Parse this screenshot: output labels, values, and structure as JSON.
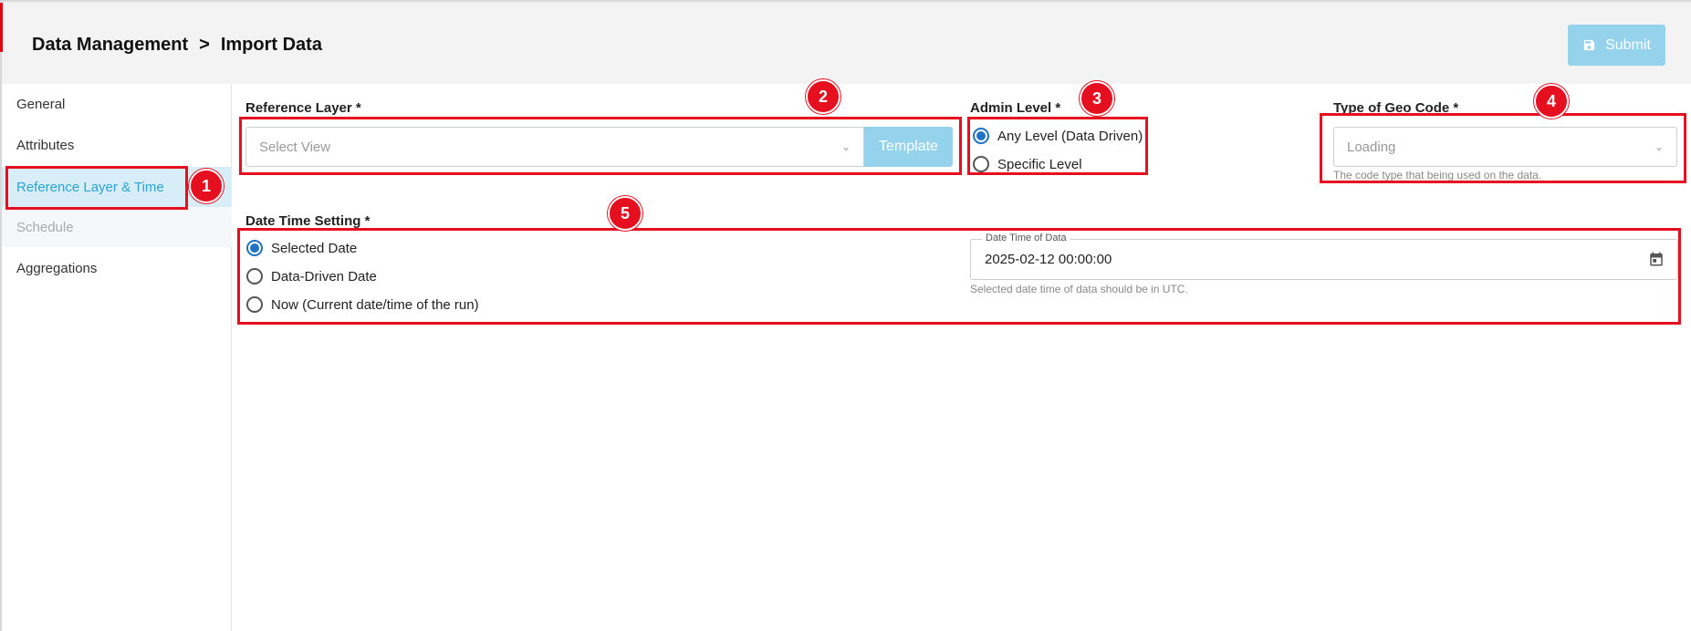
{
  "header": {
    "breadcrumb": [
      "Data Management",
      "Import Data"
    ],
    "separator": ">",
    "submit_label": "Submit"
  },
  "sidebar": {
    "items": [
      {
        "label": "General"
      },
      {
        "label": "Attributes"
      },
      {
        "label": "Reference Layer & Time"
      },
      {
        "label": "Schedule"
      },
      {
        "label": "Aggregations"
      }
    ]
  },
  "reference_layer": {
    "label": "Reference Layer *",
    "placeholder": "Select View",
    "template_label": "Template"
  },
  "admin_level": {
    "label": "Admin Level *",
    "options": [
      "Any Level (Data Driven)",
      "Specific Level"
    ],
    "selected": "Any Level (Data Driven)"
  },
  "geo_code": {
    "label": "Type of Geo Code *",
    "value": "Loading",
    "helper": "The code type that being used on the data."
  },
  "date_time_setting": {
    "label": "Date Time Setting *",
    "options": [
      "Selected Date",
      "Data-Driven Date",
      "Now (Current date/time of the run)"
    ],
    "selected": "Selected Date",
    "field_legend": "Date Time of Data",
    "field_value": "2025-02-12 00:00:00",
    "helper": "Selected date time of data should be in UTC."
  },
  "annotations": [
    "1",
    "2",
    "3",
    "4",
    "5"
  ],
  "colors": {
    "accent": "#e3000f",
    "annotation": "#e60f1f",
    "active_tab_bg": "#d7edf7",
    "active_tab_text": "#2ba4d4",
    "button_bg": "#94d3eb",
    "radio_checked": "#1f72c4"
  }
}
